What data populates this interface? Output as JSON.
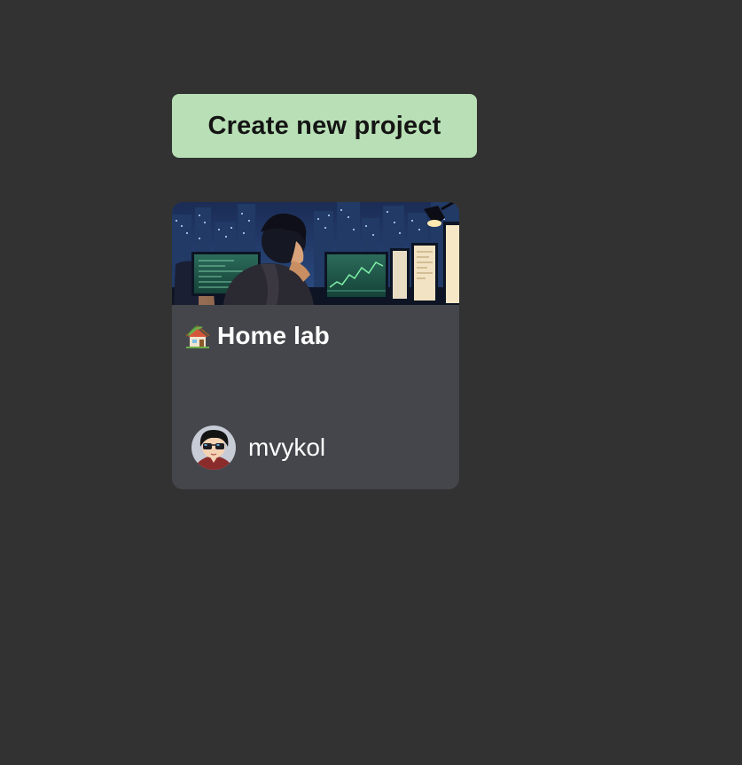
{
  "actions": {
    "create_project_label": "Create new project"
  },
  "projects": [
    {
      "title": "Home lab",
      "title_icon": "house-emoji-icon",
      "banner": "anime-hacker-at-monitors-city-night",
      "owner": {
        "username": "mvykol",
        "avatar": "anime-boy-sunglasses-avatar"
      }
    }
  ],
  "colors": {
    "background": "#323232",
    "button": "#b8dfb5",
    "card": "#45464b"
  }
}
